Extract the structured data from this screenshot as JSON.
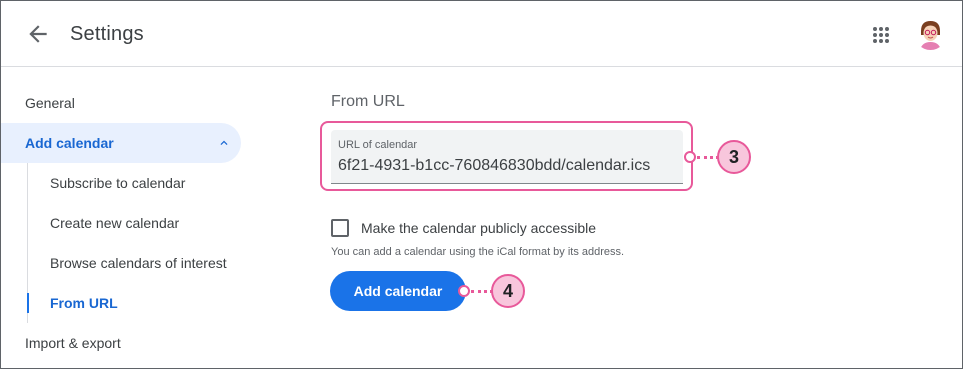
{
  "header": {
    "title": "Settings",
    "back_icon": "arrow-left-icon",
    "apps_icon": "apps-grid-icon",
    "avatar_icon": "user-avatar"
  },
  "sidebar": {
    "items": [
      {
        "label": "General"
      },
      {
        "label": "Add calendar",
        "expanded": true,
        "active": true
      },
      {
        "label": "Subscribe to calendar"
      },
      {
        "label": "Create new calendar"
      },
      {
        "label": "Browse calendars of interest"
      },
      {
        "label": "From URL",
        "active": true
      },
      {
        "label": "Import & export"
      }
    ]
  },
  "main": {
    "section_title": "From URL",
    "url_field": {
      "label": "URL of calendar",
      "value": "6f21-4931-b1cc-760846830bdd/calendar.ics"
    },
    "public_checkbox": {
      "label": "Make the calendar publicly accessible",
      "checked": false
    },
    "helper_text": "You can add a calendar using the iCal format by its address.",
    "add_button_label": "Add calendar"
  },
  "callouts": [
    {
      "number": "3"
    },
    {
      "number": "4"
    }
  ],
  "colors": {
    "accent": "#1a73e8",
    "active_bg": "#e8f0fe",
    "callout": "#e8599a",
    "callout_fill": "#f8c6dc"
  }
}
